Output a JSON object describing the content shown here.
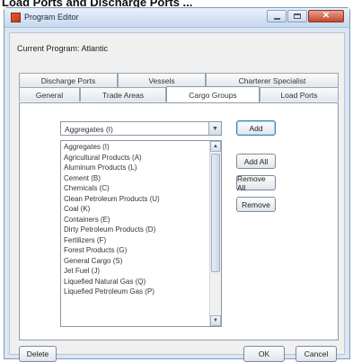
{
  "caption": "Load Ports and Discharge Ports ...",
  "window": {
    "title": "Program Editor",
    "controls": {
      "minimize_icon": "minimize-icon",
      "maximize_icon": "maximize-icon",
      "close_icon": "close-icon",
      "close_glyph": "✕"
    }
  },
  "current_program": "Current Program: Atlantic",
  "tabs": {
    "back_row": [
      {
        "label": "Discharge Ports"
      },
      {
        "label": "Vessels"
      },
      {
        "label": "Charterer Specialist"
      }
    ],
    "front_row": [
      {
        "label": "General"
      },
      {
        "label": "Trade Areas"
      },
      {
        "label": "Cargo Groups",
        "active": true
      },
      {
        "label": "Load Ports"
      }
    ]
  },
  "cargo_groups": {
    "combo_value": "Aggregates (I)",
    "combo_arrow": "▼",
    "list": [
      "Aggregates (I)",
      "Agricultural Products (A)",
      "Aluminum Products (L)",
      "Cement (B)",
      "Chemicals (C)",
      "Clean Petroleum Products (U)",
      "Coal (K)",
      "Containers (E)",
      "Dirty Petroleum Products (D)",
      "Fertilizers (F)",
      "Forest Products (G)",
      "General Cargo (S)",
      "Jet Fuel (J)",
      "Liquefied Natural Gas (Q)",
      "Liquefied Petroleum Gas (P)"
    ],
    "scroll_up": "▲",
    "scroll_down": "▼"
  },
  "buttons": {
    "add": "Add",
    "add_all": "Add All",
    "remove_all": "Remove All",
    "remove": "Remove",
    "delete": "Delete",
    "ok": "OK",
    "cancel": "Cancel"
  },
  "colors": {
    "accent": "#3c7fb1",
    "title_bar": "#c7d8ee",
    "close": "#c2492e"
  }
}
